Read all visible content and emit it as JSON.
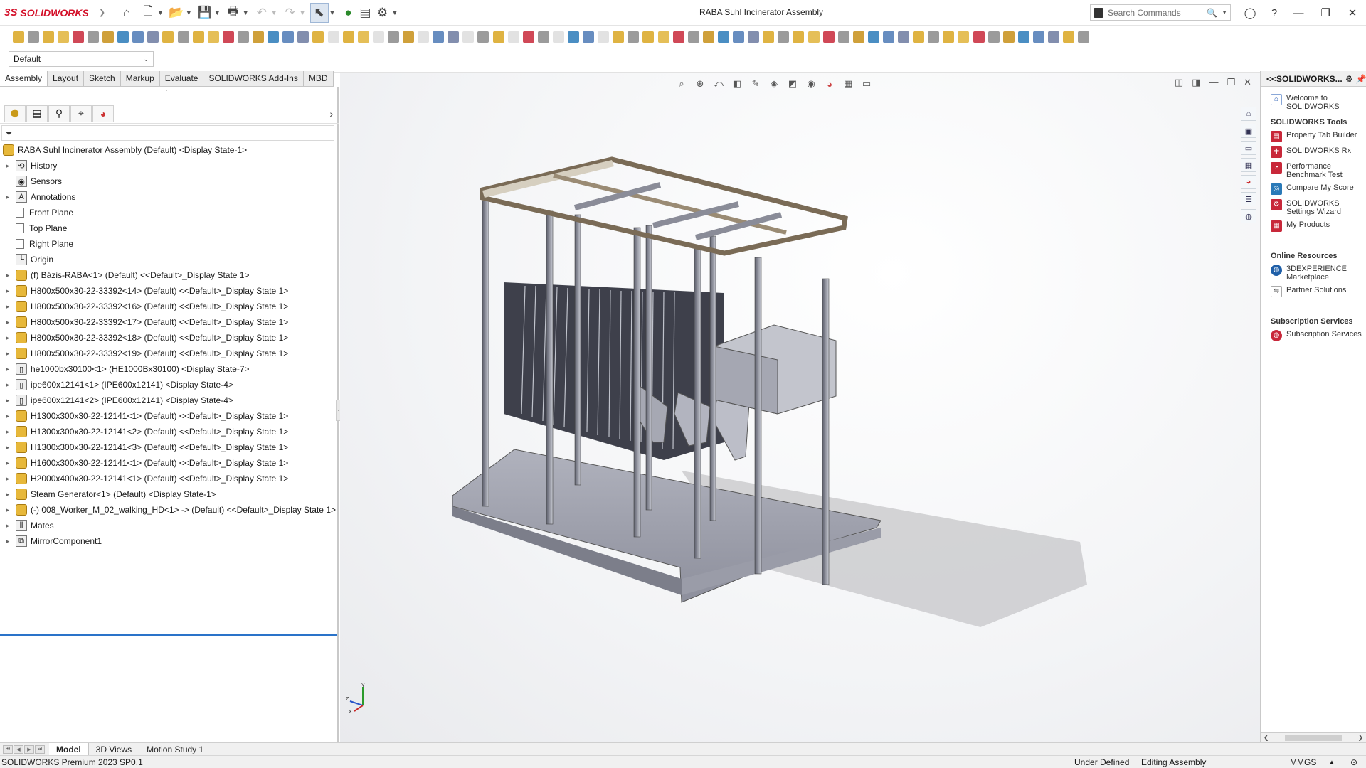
{
  "app": {
    "brand_ds": "3S",
    "brand_name": "SOLIDWORKS",
    "title": "RABA Suhl Incinerator Assembly"
  },
  "search": {
    "placeholder": "Search Commands"
  },
  "config": {
    "selected": "Default"
  },
  "tabs": [
    "Assembly",
    "Layout",
    "Sketch",
    "Markup",
    "Evaluate",
    "SOLIDWORKS Add-Ins",
    "MBD"
  ],
  "tree": {
    "root": "RABA Suhl Incinerator Assembly (Default) <Display State-1>",
    "items": [
      {
        "label": "History",
        "icon": "history",
        "exp": true
      },
      {
        "label": "Sensors",
        "icon": "sensor",
        "exp": false
      },
      {
        "label": "Annotations",
        "icon": "annotation",
        "exp": true
      },
      {
        "label": "Front Plane",
        "icon": "plane",
        "exp": false
      },
      {
        "label": "Top Plane",
        "icon": "plane",
        "exp": false
      },
      {
        "label": "Right Plane",
        "icon": "plane",
        "exp": false
      },
      {
        "label": "Origin",
        "icon": "origin",
        "exp": false
      },
      {
        "label": "(f) Bázis-RABA<1> (Default) <<Default>_Display State 1>",
        "icon": "asm",
        "exp": true
      },
      {
        "label": "H800x500x30-22-33392<14> (Default) <<Default>_Display State 1>",
        "icon": "asm",
        "exp": true
      },
      {
        "label": "H800x500x30-22-33392<16> (Default) <<Default>_Display State 1>",
        "icon": "asm",
        "exp": true
      },
      {
        "label": "H800x500x30-22-33392<17> (Default) <<Default>_Display State 1>",
        "icon": "asm",
        "exp": true
      },
      {
        "label": "H800x500x30-22-33392<18> (Default) <<Default>_Display State 1>",
        "icon": "asm",
        "exp": true
      },
      {
        "label": "H800x500x30-22-33392<19> (Default) <<Default>_Display State 1>",
        "icon": "asm",
        "exp": true
      },
      {
        "label": "he1000bx30100<1> (HE1000Bx30100) <Display State-7>",
        "icon": "part",
        "exp": true
      },
      {
        "label": "ipe600x12141<1> (IPE600x12141) <Display State-4>",
        "icon": "part",
        "exp": true
      },
      {
        "label": "ipe600x12141<2> (IPE600x12141) <Display State-4>",
        "icon": "part",
        "exp": true
      },
      {
        "label": "H1300x300x30-22-12141<1> (Default) <<Default>_Display State 1>",
        "icon": "asm",
        "exp": true
      },
      {
        "label": "H1300x300x30-22-12141<2> (Default) <<Default>_Display State 1>",
        "icon": "asm",
        "exp": true
      },
      {
        "label": "H1300x300x30-22-12141<3> (Default) <<Default>_Display State 1>",
        "icon": "asm",
        "exp": true
      },
      {
        "label": "H1600x300x30-22-12141<1> (Default) <<Default>_Display State 1>",
        "icon": "asm",
        "exp": true
      },
      {
        "label": "H2000x400x30-22-12141<1> (Default) <<Default>_Display State 1>",
        "icon": "asm",
        "exp": true
      },
      {
        "label": "Steam Generator<1> (Default) <Display State-1>",
        "icon": "asm",
        "exp": true
      },
      {
        "label": "(-) 008_Worker_M_02_walking_HD<1> -> (Default) <<Default>_Display State 1>",
        "icon": "asm",
        "exp": true
      },
      {
        "label": "Mates",
        "icon": "mates",
        "exp": true
      },
      {
        "label": "MirrorComponent1",
        "icon": "mirror",
        "exp": true
      }
    ]
  },
  "taskpane": {
    "header": "<<SOLIDWORKS...",
    "welcome": "Welcome to SOLIDWORKS",
    "tools_title": "SOLIDWORKS Tools",
    "tools": [
      "Property Tab Builder",
      "SOLIDWORKS Rx",
      "Performance Benchmark Test",
      "Compare My Score",
      "SOLIDWORKS Settings Wizard",
      "My Products"
    ],
    "online_title": "Online Resources",
    "online": [
      "3DEXPERIENCE Marketplace",
      "Partner Solutions"
    ],
    "sub_title": "Subscription Services",
    "sub": [
      "Subscription Services"
    ]
  },
  "bottom_tabs": [
    "Model",
    "3D Views",
    "Motion Study 1"
  ],
  "status": {
    "product": "SOLIDWORKS Premium 2023 SP0.1",
    "state": "Under Defined",
    "mode": "Editing Assembly",
    "units": "MMGS"
  },
  "colors": {
    "brand": "#d4112a",
    "selection": "#2a73c9"
  }
}
